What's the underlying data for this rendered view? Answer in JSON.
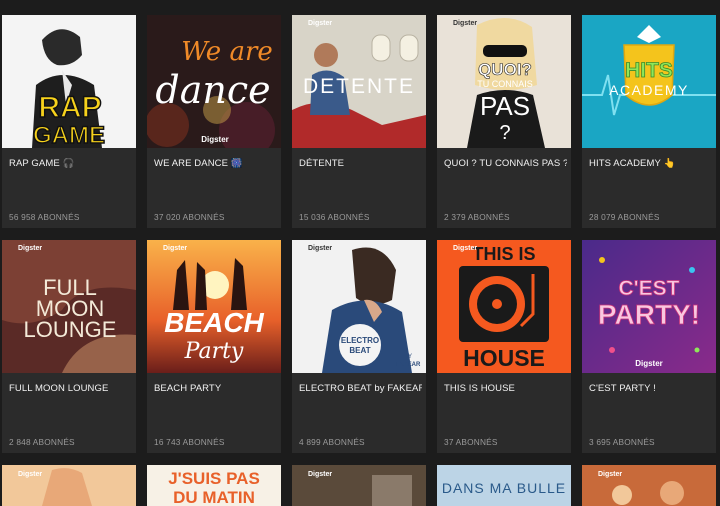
{
  "brand": "Digster",
  "playlists": [
    {
      "title": "RAP GAME 🎧",
      "subs": "56 958 ABONNÉS",
      "art_text": [
        "RAP",
        "GAME"
      ]
    },
    {
      "title": "WE ARE DANCE 🎆",
      "subs": "37 020 ABONNÉS",
      "art_text": [
        "We are",
        "dance"
      ]
    },
    {
      "title": "DÉTENTE",
      "subs": "15 036 ABONNÉS",
      "art_text": [
        "DETENTE"
      ]
    },
    {
      "title": "QUOI ? TU CONNAIS PAS ?",
      "subs": "2 379 ABONNÉS",
      "art_text": [
        "QUOI?",
        "TU CONNAIS",
        "PAS",
        "?"
      ]
    },
    {
      "title": "HITS ACADEMY 👆",
      "subs": "28 079 ABONNÉS",
      "art_text": [
        "HITS",
        "ACADEMY"
      ]
    },
    {
      "title": "FULL MOON LOUNGE",
      "subs": "2 848 ABONNÉS",
      "art_text": [
        "FULL",
        "MOON",
        "LOUNGE"
      ]
    },
    {
      "title": "BEACH PARTY",
      "subs": "16 743 ABONNÉS",
      "art_text": [
        "BEACH",
        "Party"
      ]
    },
    {
      "title": "ELECTRO BEAT by FAKEAR",
      "subs": "4 899 ABONNÉS",
      "art_text": [
        "ELECTRO",
        "BEAT",
        "BY",
        "FAKEAR"
      ]
    },
    {
      "title": "THIS IS HOUSE",
      "subs": "37 ABONNÉS",
      "art_text": [
        "THIS IS",
        "HOUSE"
      ]
    },
    {
      "title": "C'EST PARTY !",
      "subs": "3 695 ABONNÉS",
      "art_text": [
        "C'EST",
        "PARTY!"
      ]
    },
    {
      "title": "",
      "subs": "",
      "art_text": []
    },
    {
      "title": "",
      "subs": "",
      "art_text": [
        "J'SUIS PAS",
        "DU MATIN"
      ]
    },
    {
      "title": "",
      "subs": "",
      "art_text": []
    },
    {
      "title": "",
      "subs": "",
      "art_text": [
        "DANS MA BULLE"
      ]
    },
    {
      "title": "",
      "subs": "",
      "art_text": []
    }
  ],
  "colors": {
    "background": "#1c1c1c",
    "card": "#2b2b2b",
    "subtext": "#9a9a9a"
  }
}
